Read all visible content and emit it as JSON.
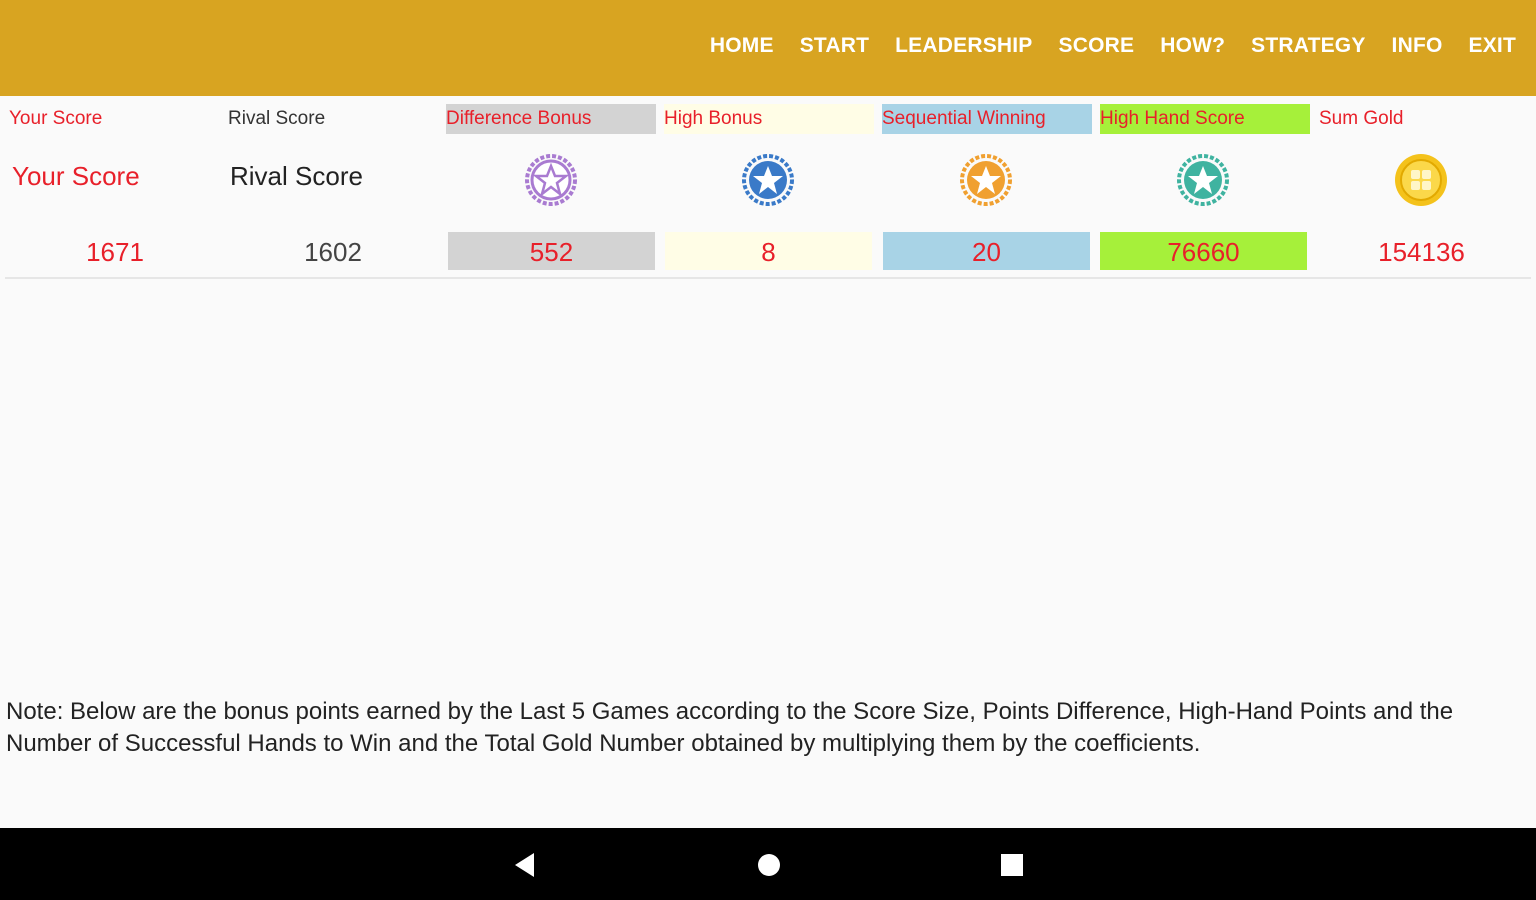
{
  "nav": {
    "items": [
      "HOME",
      "START",
      "LEADERSHIP",
      "SCORE",
      "HOW?",
      "STRATEGY",
      "INFO",
      "EXIT"
    ]
  },
  "headers": {
    "your_score": "Your Score",
    "rival_score": "Rival Score",
    "difference_bonus": "Difference Bonus",
    "high_bonus": "High Bonus",
    "sequential_winning": "Sequential Winning",
    "high_hand_score": "High Hand Score",
    "sum_gold": "Sum Gold"
  },
  "labels": {
    "your_score": "Your Score",
    "rival_score": "Rival Score"
  },
  "values": {
    "your_score": "1671",
    "rival_score": "1602",
    "difference_bonus": "552",
    "high_bonus": "8",
    "sequential_winning": "20",
    "high_hand_score": "76660",
    "sum_gold": "154136"
  },
  "icons": {
    "difference_bonus": "purple-star-medal-icon",
    "high_bonus": "blue-star-medal-icon",
    "sequential_winning": "orange-star-medal-icon",
    "high_hand_score": "teal-star-medal-icon",
    "sum_gold": "gold-coin-icon"
  },
  "colors": {
    "appbar": "#d8a421",
    "accent_red": "#e8202a",
    "difference_bg": "#d3d3d3",
    "high_bonus_bg": "#fffde6",
    "sequential_bg": "#a8d3e6",
    "high_hand_bg": "#a6f03a"
  },
  "note": "Note: Below are the bonus points earned by the Last 5 Games according to the Score Size, Points Difference, High-Hand Points and the Number of Successful Hands to Win and the Total Gold Number obtained by multiplying them by the coefficients."
}
